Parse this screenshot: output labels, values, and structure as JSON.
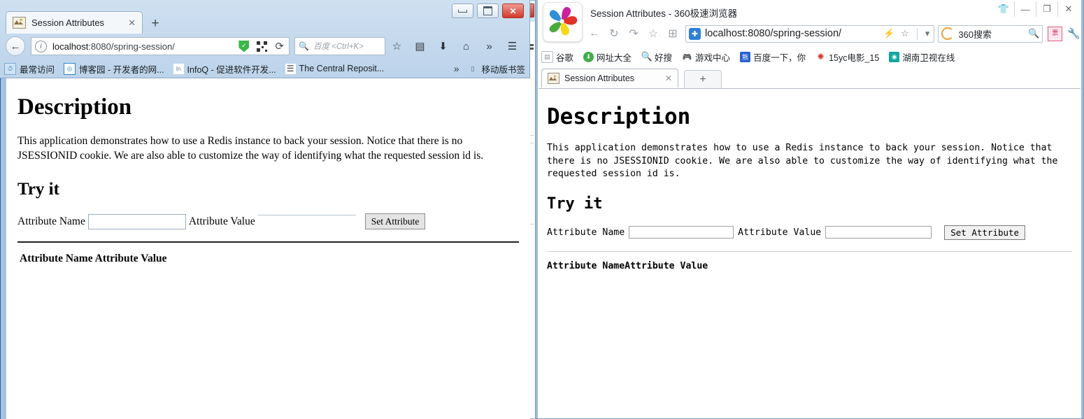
{
  "desktop": {
    "background_color": "#1d5fa8"
  },
  "window_behind": {
    "name": "hidden-window-sliver",
    "fragments": [
      "ɔɛ",
      "ɔɔ",
      "签",
      ".t"
    ]
  },
  "window_firefox": {
    "titlebar": {
      "minimize_label": "—",
      "maximize_label": "□",
      "close_label": "✕"
    },
    "tab": {
      "title": "Session Attributes",
      "close_label": "✕",
      "new_tab_label": "+"
    },
    "nav": {
      "back_label": "←",
      "info_icon": "i",
      "url_host": "localhost",
      "url_path": ":8080/spring-session/",
      "shield_icon": "shield-icon",
      "qr_icon": "qr-icon",
      "reload_label": "⟳",
      "search_placeholder": "百度 <Ctrl+K>",
      "bookmark_star": "☆",
      "library_icon": "📋",
      "downloads_icon": "⬇",
      "home_icon": "⌂",
      "overflow_icon": "»",
      "menu_icon": "☰"
    },
    "bookmarks": [
      {
        "label": "最常访问",
        "icon": "history-icon",
        "color": "#4c8fd0"
      },
      {
        "label": "博客园 - 开发者的网...",
        "icon": "blog-icon",
        "color": "#2f86c5"
      },
      {
        "label": "InfoQ - 促进软件开发...",
        "icon": "infoq-icon",
        "color": "#6f7880"
      },
      {
        "label": "The Central Reposit...",
        "icon": "list-icon",
        "color": "#333333"
      }
    ],
    "bookmarks_right": {
      "overflow_label": "»",
      "mobile_label": "移动版书签",
      "mobile_icon": "phone-icon"
    },
    "page": {
      "heading_description": "Description",
      "paragraph": "This application demonstrates how to use a Redis instance to back your session. Notice that there is no JSESSIONID cookie. We are also able to customize the way of identifying what the requested session id is.",
      "heading_try_it": "Try it",
      "label_attribute_name": "Attribute Name",
      "label_attribute_value": "Attribute Value",
      "input_attribute_name_value": "",
      "input_attribute_value_value": "",
      "button_set_attribute": "Set Attribute",
      "table_header_name": "Attribute Name",
      "table_header_value": "Attribute Value"
    }
  },
  "window_360": {
    "titlebar": {
      "title": "Session Attributes - 360极速浏览器",
      "logo_icon": "360-pinwheel-logo",
      "skin_label": "👕",
      "minimize_label": "—",
      "maximize_label": "❐",
      "close_label": "✕"
    },
    "nav": {
      "back_label": "←",
      "forward_label": "↻",
      "history_label": "↷",
      "favorite_label": "☆",
      "apps_label": "⊞",
      "shield_icon": "blue-shield-icon",
      "url": "localhost:8080/spring-session/",
      "lightning_label": "⚡",
      "star_label": "☆",
      "dropdown_label": "▾",
      "search_engine": "360搜索",
      "search_icon": "magnifier-icon",
      "coupon_label": "票",
      "wrench_label": "🔧"
    },
    "bookmarks": [
      {
        "label": "谷歌",
        "icon": "page-icon",
        "color": "#ffffff"
      },
      {
        "label": "网址大全",
        "icon": "hao360-icon",
        "color": "#3fae49"
      },
      {
        "label": "好搜",
        "icon": "haosou-icon",
        "color": "#2aa7e0"
      },
      {
        "label": "游戏中心",
        "icon": "game-icon",
        "color": "#8d949b"
      },
      {
        "label": "百度一下，你",
        "icon": "baidu-icon",
        "color": "#2b5fcc"
      },
      {
        "label": "15yc电影_15",
        "icon": "movie-icon",
        "color": "#d0342c"
      },
      {
        "label": "湖南卫视在线",
        "icon": "hunantv-icon",
        "color": "#14a6a0"
      }
    ],
    "tab": {
      "title": "Session Attributes",
      "close_label": "✕",
      "new_tab_label": "+"
    },
    "page": {
      "heading_description": "Description",
      "paragraph": "This application demonstrates how to use a Redis instance to back your session. Notice that there is no JSESSIONID cookie. We are also able to customize the way of identifying what the requested session id is.",
      "heading_try_it": "Try it",
      "label_attribute_name": "Attribute Name",
      "label_attribute_value": "Attribute Value",
      "input_attribute_name_value": "",
      "input_attribute_value_value": "",
      "button_set_attribute": "Set Attribute",
      "table_header_name": "Attribute Name",
      "table_header_value": "Attribute Value"
    }
  }
}
